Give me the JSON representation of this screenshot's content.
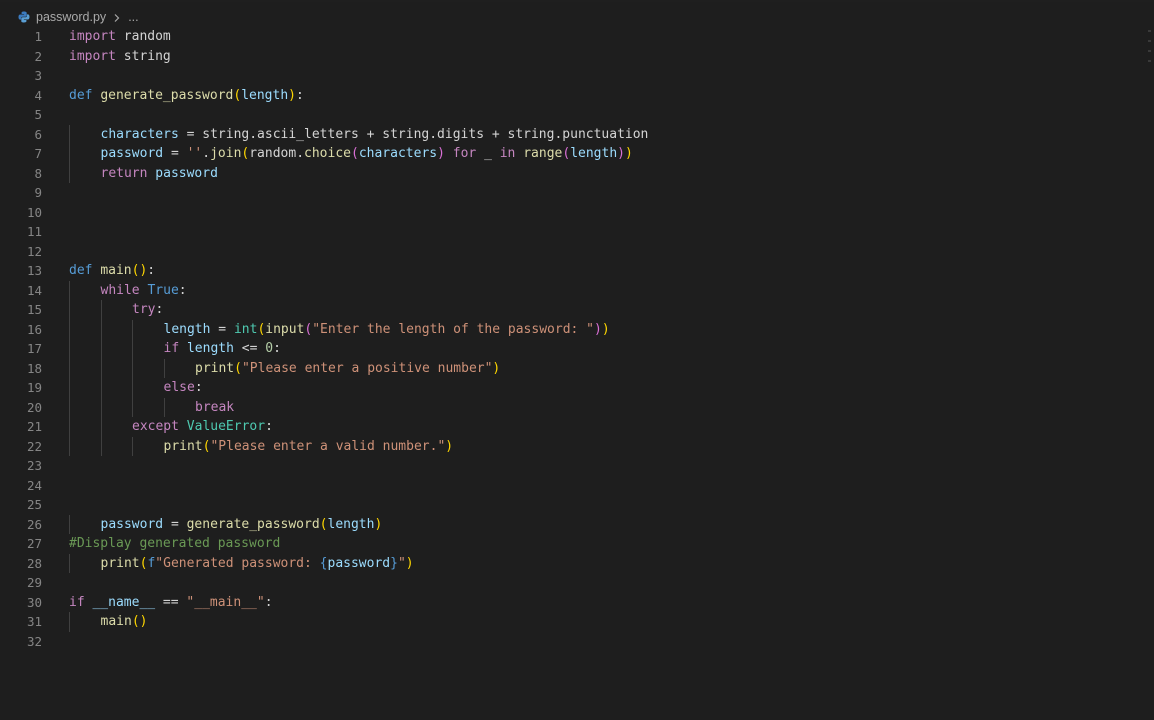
{
  "breadcrumb": {
    "file": "password.py",
    "more": "..."
  },
  "colors": {
    "background": "#1e1e1e",
    "keyword": "#c586c0",
    "function": "#dcdcaa",
    "variable": "#9cdcfe",
    "string": "#ce9178",
    "comment": "#6a9955",
    "class": "#4ec9b0",
    "line_number": "#858585"
  },
  "icons": {
    "file": "python-icon",
    "separator": "chevron-right-icon"
  },
  "lines": [
    {
      "n": "1",
      "indent": 0,
      "tokens": [
        [
          "kw",
          "import"
        ],
        [
          "pun",
          " random"
        ]
      ]
    },
    {
      "n": "2",
      "indent": 0,
      "tokens": [
        [
          "kw",
          "import"
        ],
        [
          "pun",
          " string"
        ]
      ]
    },
    {
      "n": "3",
      "indent": 0,
      "tokens": []
    },
    {
      "n": "4",
      "indent": 0,
      "tokens": [
        [
          "def",
          "def"
        ],
        [
          "pun",
          " "
        ],
        [
          "fn",
          "generate_password"
        ],
        [
          "b1",
          "("
        ],
        [
          "var",
          "length"
        ],
        [
          "b1",
          ")"
        ],
        [
          "pun",
          ":"
        ]
      ]
    },
    {
      "n": "5",
      "indent": 0,
      "tokens": []
    },
    {
      "n": "6",
      "indent": 1,
      "tokens": [
        [
          "var",
          "characters"
        ],
        [
          "pun",
          " = string.ascii_letters + string.digits + string.punctuation"
        ]
      ]
    },
    {
      "n": "7",
      "indent": 1,
      "tokens": [
        [
          "var",
          "password"
        ],
        [
          "pun",
          " = "
        ],
        [
          "str",
          "''"
        ],
        [
          "pun",
          "."
        ],
        [
          "fn",
          "join"
        ],
        [
          "b1",
          "("
        ],
        [
          "pun",
          "random."
        ],
        [
          "fn",
          "choice"
        ],
        [
          "b2",
          "("
        ],
        [
          "var",
          "characters"
        ],
        [
          "b2",
          ")"
        ],
        [
          "pun",
          " "
        ],
        [
          "kw",
          "for"
        ],
        [
          "pun",
          " _ "
        ],
        [
          "kw",
          "in"
        ],
        [
          "pun",
          " "
        ],
        [
          "fn",
          "range"
        ],
        [
          "b2",
          "("
        ],
        [
          "var",
          "length"
        ],
        [
          "b2",
          ")"
        ],
        [
          "b1",
          ")"
        ]
      ]
    },
    {
      "n": "8",
      "indent": 1,
      "tokens": [
        [
          "kw",
          "return"
        ],
        [
          "pun",
          " "
        ],
        [
          "var",
          "password"
        ]
      ]
    },
    {
      "n": "9",
      "indent": 0,
      "tokens": []
    },
    {
      "n": "10",
      "indent": 0,
      "tokens": []
    },
    {
      "n": "11",
      "indent": 0,
      "tokens": []
    },
    {
      "n": "12",
      "indent": 0,
      "tokens": []
    },
    {
      "n": "13",
      "indent": 0,
      "tokens": [
        [
          "def",
          "def"
        ],
        [
          "pun",
          " "
        ],
        [
          "fn",
          "main"
        ],
        [
          "b1",
          "()"
        ],
        [
          "pun",
          ":"
        ]
      ]
    },
    {
      "n": "14",
      "indent": 1,
      "tokens": [
        [
          "kw",
          "while"
        ],
        [
          "pun",
          " "
        ],
        [
          "const",
          "True"
        ],
        [
          "pun",
          ":"
        ]
      ]
    },
    {
      "n": "15",
      "indent": 2,
      "tokens": [
        [
          "kw",
          "try"
        ],
        [
          "pun",
          ":"
        ]
      ]
    },
    {
      "n": "16",
      "indent": 3,
      "tokens": [
        [
          "var",
          "length"
        ],
        [
          "pun",
          " = "
        ],
        [
          "cls",
          "int"
        ],
        [
          "b1",
          "("
        ],
        [
          "fn",
          "input"
        ],
        [
          "b2",
          "("
        ],
        [
          "str",
          "\"Enter the length of the password: \""
        ],
        [
          "b2",
          ")"
        ],
        [
          "b1",
          ")"
        ]
      ]
    },
    {
      "n": "17",
      "indent": 3,
      "tokens": [
        [
          "kw",
          "if"
        ],
        [
          "pun",
          " "
        ],
        [
          "var",
          "length"
        ],
        [
          "pun",
          " <= "
        ],
        [
          "num",
          "0"
        ],
        [
          "pun",
          ":"
        ]
      ]
    },
    {
      "n": "18",
      "indent": 4,
      "tokens": [
        [
          "fn",
          "print"
        ],
        [
          "b1",
          "("
        ],
        [
          "str",
          "\"Please enter a positive number\""
        ],
        [
          "b1",
          ")"
        ]
      ]
    },
    {
      "n": "19",
      "indent": 3,
      "tokens": [
        [
          "kw",
          "else"
        ],
        [
          "pun",
          ":"
        ]
      ]
    },
    {
      "n": "20",
      "indent": 4,
      "tokens": [
        [
          "kw",
          "break"
        ]
      ]
    },
    {
      "n": "21",
      "indent": 2,
      "tokens": [
        [
          "kw",
          "except"
        ],
        [
          "pun",
          " "
        ],
        [
          "cls",
          "ValueError"
        ],
        [
          "pun",
          ":"
        ]
      ]
    },
    {
      "n": "22",
      "indent": 3,
      "tokens": [
        [
          "fn",
          "print"
        ],
        [
          "b1",
          "("
        ],
        [
          "str",
          "\"Please enter a valid number.\""
        ],
        [
          "b1",
          ")"
        ]
      ]
    },
    {
      "n": "23",
      "indent": 0,
      "tokens": []
    },
    {
      "n": "24",
      "indent": 0,
      "tokens": []
    },
    {
      "n": "25",
      "indent": 0,
      "tokens": []
    },
    {
      "n": "26",
      "indent": 1,
      "tokens": [
        [
          "var",
          "password"
        ],
        [
          "pun",
          " = "
        ],
        [
          "fn",
          "generate_password"
        ],
        [
          "b1",
          "("
        ],
        [
          "var",
          "length"
        ],
        [
          "b1",
          ")"
        ]
      ]
    },
    {
      "n": "27",
      "indent": 0,
      "tokens": [
        [
          "cmt",
          "#Display generated password"
        ]
      ]
    },
    {
      "n": "28",
      "indent": 1,
      "tokens": [
        [
          "fn",
          "print"
        ],
        [
          "b1",
          "("
        ],
        [
          "def",
          "f"
        ],
        [
          "str",
          "\"Generated password: "
        ],
        [
          "def",
          "{"
        ],
        [
          "var",
          "password"
        ],
        [
          "def",
          "}"
        ],
        [
          "str",
          "\""
        ],
        [
          "b1",
          ")"
        ]
      ]
    },
    {
      "n": "29",
      "indent": 0,
      "tokens": []
    },
    {
      "n": "30",
      "indent": 0,
      "tokens": [
        [
          "kw",
          "if"
        ],
        [
          "pun",
          " "
        ],
        [
          "var",
          "__name__"
        ],
        [
          "pun",
          " == "
        ],
        [
          "str",
          "\"__main__\""
        ],
        [
          "pun",
          ":"
        ]
      ]
    },
    {
      "n": "31",
      "indent": 1,
      "tokens": [
        [
          "fn",
          "main"
        ],
        [
          "b1",
          "()"
        ]
      ]
    },
    {
      "n": "32",
      "indent": 0,
      "tokens": []
    }
  ]
}
